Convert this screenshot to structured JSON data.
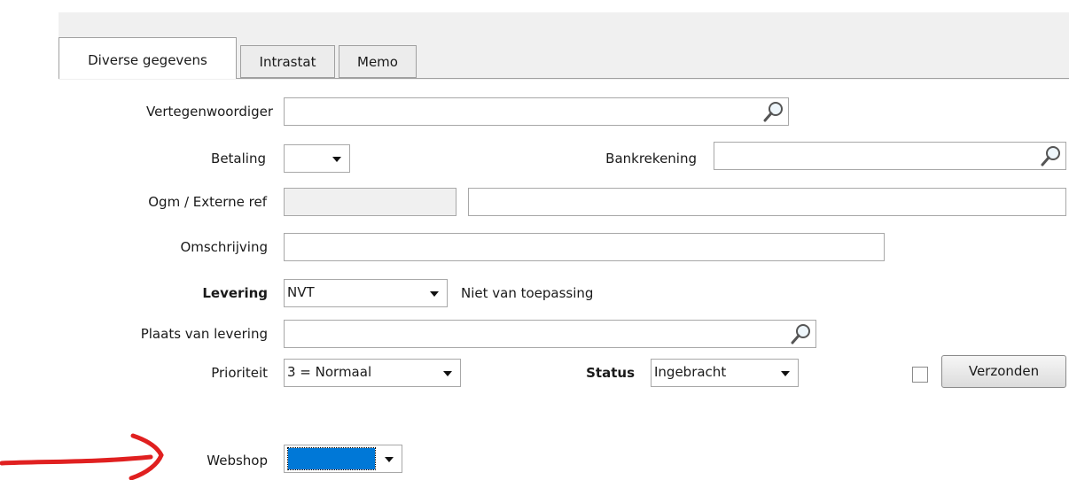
{
  "tabs": [
    "Diverse gegevens",
    "Intrastat",
    "Memo"
  ],
  "fields": {
    "vertegenwoordiger": {
      "label": "Vertegenwoordiger",
      "value": ""
    },
    "betaling": {
      "label": "Betaling",
      "value": ""
    },
    "bankrekening": {
      "label": "Bankrekening",
      "value": ""
    },
    "ogm": {
      "label": "Ogm / Externe ref",
      "value1": "",
      "value2": ""
    },
    "omschrijving": {
      "label": "Omschrijving",
      "value": ""
    },
    "levering": {
      "label": "Levering",
      "value": "NVT",
      "description": "Niet van toepassing"
    },
    "plaats": {
      "label": "Plaats van levering",
      "value": ""
    },
    "prioriteit": {
      "label": "Prioriteit",
      "value": "3 = Normaal"
    },
    "status": {
      "label": "Status",
      "value": "Ingebracht"
    },
    "webshop": {
      "label": "Webshop",
      "selected_color": "#0078d7"
    }
  },
  "verzonden": {
    "label": "Verzonden",
    "checked": false
  },
  "annotation": {
    "arrow_color": "#e02020"
  },
  "icons": {
    "lookup": "magnifier-icon",
    "dropdown": "chevron-down-icon"
  }
}
